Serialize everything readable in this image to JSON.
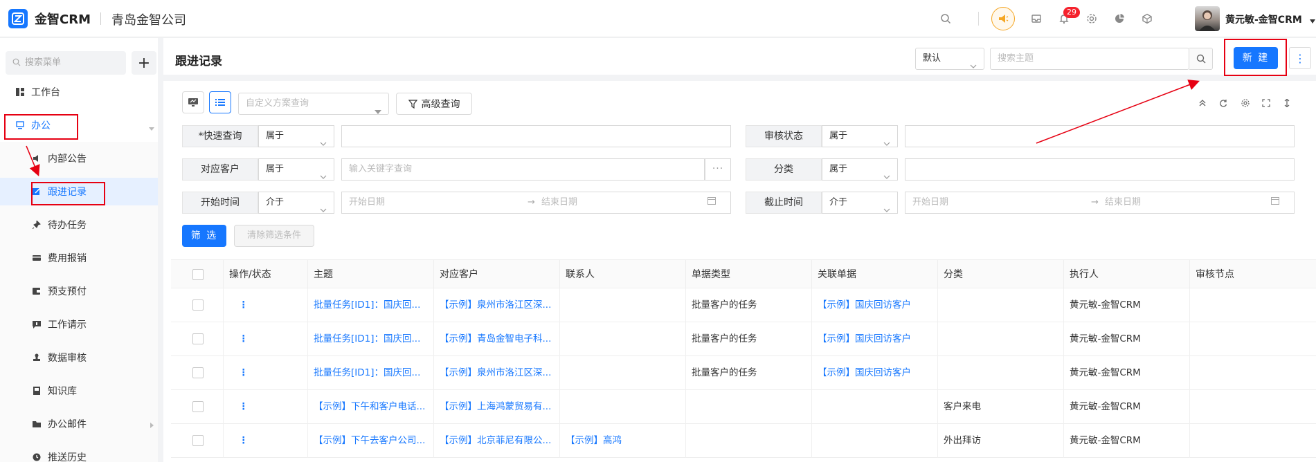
{
  "app": {
    "name": "金智CRM",
    "company": "青岛金智公司"
  },
  "header": {
    "notification_count": "29",
    "user_name": "黄元敏-金智CRM"
  },
  "sidebar": {
    "search_placeholder": "搜索菜单",
    "items": [
      {
        "label": "工作台",
        "icon": "dashboard-icon"
      },
      {
        "label": "办公",
        "icon": "desktop-icon"
      },
      {
        "label": "内部公告",
        "icon": "speaker-icon"
      },
      {
        "label": "跟进记录",
        "icon": "edit-icon"
      },
      {
        "label": "待办任务",
        "icon": "pin-icon"
      },
      {
        "label": "费用报销",
        "icon": "card-icon"
      },
      {
        "label": "预支预付",
        "icon": "wallet-icon"
      },
      {
        "label": "工作请示",
        "icon": "message-icon"
      },
      {
        "label": "数据审核",
        "icon": "stamp-icon"
      },
      {
        "label": "知识库",
        "icon": "book-icon"
      },
      {
        "label": "办公邮件",
        "icon": "folder-icon"
      },
      {
        "label": "推送历史",
        "icon": "clock-icon"
      }
    ]
  },
  "page": {
    "title": "跟进记录",
    "sort_value": "默认",
    "search_placeholder": "搜索主题",
    "new_label": "新 建"
  },
  "filters": {
    "scheme_placeholder": "自定义方案查询",
    "advanced_label": "高级查询",
    "rows": [
      {
        "label": "*快速查询",
        "op": "属于",
        "value": ""
      },
      {
        "label": "审核状态",
        "op": "属于",
        "value": ""
      },
      {
        "label": "对应客户",
        "op": "属于",
        "value": "输入关键字查询"
      },
      {
        "label": "分类",
        "op": "属于",
        "value": ""
      },
      {
        "label": "开始时间",
        "op": "介于",
        "start": "开始日期",
        "end": "结束日期"
      },
      {
        "label": "截止时间",
        "op": "介于",
        "start": "开始日期",
        "end": "结束日期"
      }
    ],
    "filter_label": "筛 选",
    "clear_label": "清除筛选条件",
    "dots": "···"
  },
  "table": {
    "columns": [
      "操作/状态",
      "主题",
      "对应客户",
      "联系人",
      "单据类型",
      "关联单据",
      "分类",
      "执行人",
      "审核节点"
    ],
    "rows": [
      [
        "⋮",
        "批量任务[ID1]：国庆回...",
        "【示例】泉州市洛江区深...",
        "",
        "批量客户的任务",
        "【示例】国庆回访客户",
        "",
        "黄元敏-金智CRM",
        ""
      ],
      [
        "⋮",
        "批量任务[ID1]：国庆回...",
        "【示例】青岛金智电子科...",
        "",
        "批量客户的任务",
        "【示例】国庆回访客户",
        "",
        "黄元敏-金智CRM",
        ""
      ],
      [
        "⋮",
        "批量任务[ID1]：国庆回...",
        "【示例】泉州市洛江区深...",
        "",
        "批量客户的任务",
        "【示例】国庆回访客户",
        "",
        "黄元敏-金智CRM",
        ""
      ],
      [
        "⋮",
        "【示例】下午和客户电话...",
        "【示例】上海鸿蒙贸易有...",
        "",
        "",
        "",
        "客户来电",
        "黄元敏-金智CRM",
        ""
      ],
      [
        "⋮",
        "【示例】下午去客户公司...",
        "【示例】北京菲尼有限公...",
        "【示例】高鸿",
        "",
        "",
        "外出拜访",
        "黄元敏-金智CRM",
        ""
      ]
    ]
  },
  "colors": {
    "accent": "#1677ff",
    "annotation": "#e60012",
    "badge": "#f5222d"
  }
}
